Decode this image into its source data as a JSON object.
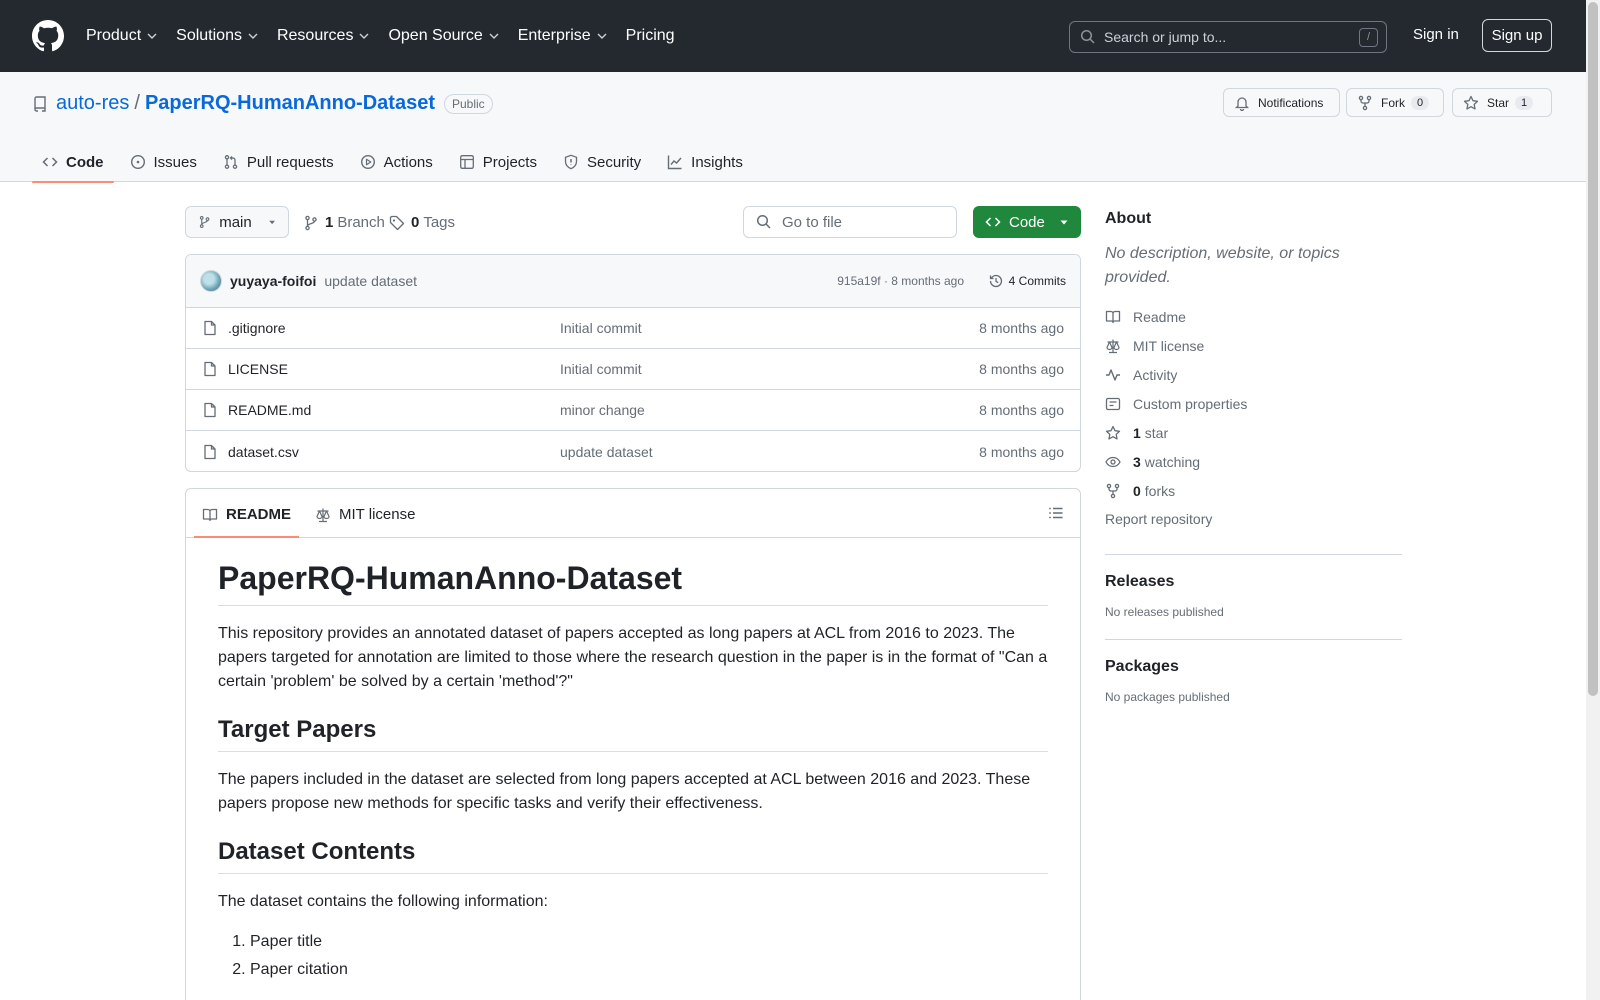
{
  "header": {
    "nav": [
      "Product",
      "Solutions",
      "Resources",
      "Open Source",
      "Enterprise",
      "Pricing"
    ],
    "search_placeholder": "Search or jump to...",
    "search_shortcut": "/",
    "sign_in": "Sign in",
    "sign_up": "Sign up"
  },
  "repo": {
    "owner": "auto-res",
    "separator": "/",
    "name": "PaperRQ-HumanAnno-Dataset",
    "visibility": "Public",
    "notifications_label": "Notifications",
    "fork_label": "Fork",
    "fork_count": "0",
    "star_label": "Star",
    "star_count": "1"
  },
  "tabs": [
    {
      "label": "Code",
      "icon": "code-icon"
    },
    {
      "label": "Issues",
      "icon": "issue-icon"
    },
    {
      "label": "Pull requests",
      "icon": "pull-request-icon"
    },
    {
      "label": "Actions",
      "icon": "play-icon"
    },
    {
      "label": "Projects",
      "icon": "table-icon"
    },
    {
      "label": "Security",
      "icon": "shield-icon"
    },
    {
      "label": "Insights",
      "icon": "graph-icon"
    }
  ],
  "toolbar": {
    "branch": "main",
    "branch_count": "1",
    "branch_label": "Branch",
    "tag_count": "0",
    "tag_label": "Tags",
    "goto_placeholder": "Go to file",
    "code_label": "Code"
  },
  "latest_commit": {
    "author": "yuyaya-foifoi",
    "message": "update dataset",
    "hash_time": "915a19f · 8 months ago",
    "commits_label": "4 Commits"
  },
  "files": [
    {
      "name": ".gitignore",
      "commit": "Initial commit",
      "time": "8 months ago"
    },
    {
      "name": "LICENSE",
      "commit": "Initial commit",
      "time": "8 months ago"
    },
    {
      "name": "README.md",
      "commit": "minor change",
      "time": "8 months ago"
    },
    {
      "name": "dataset.csv",
      "commit": "update dataset",
      "time": "8 months ago"
    }
  ],
  "readme": {
    "tab_readme": "README",
    "tab_license": "MIT license",
    "title": "PaperRQ-HumanAnno-Dataset",
    "intro": "This repository provides an annotated dataset of papers accepted as long papers at ACL from 2016 to 2023. The papers targeted for annotation are limited to those where the research question in the paper is in the format of \"Can a certain 'problem' be solved by a certain 'method'?\"",
    "h_target": "Target Papers",
    "p_target": "The papers included in the dataset are selected from long papers accepted at ACL between 2016 and 2023. These papers propose new methods for specific tasks and verify their effectiveness.",
    "h_contents": "Dataset Contents",
    "p_contents": "The dataset contains the following information:",
    "list": [
      "Paper title",
      "Paper citation"
    ]
  },
  "about": {
    "title": "About",
    "description": "No description, website, or topics provided.",
    "readme": "Readme",
    "license": "MIT license",
    "activity": "Activity",
    "custom": "Custom properties",
    "stars_count": "1",
    "stars_label": "star",
    "watching_count": "3",
    "watching_label": "watching",
    "forks_count": "0",
    "forks_label": "forks",
    "report": "Report repository"
  },
  "releases": {
    "title": "Releases",
    "empty": "No releases published"
  },
  "packages": {
    "title": "Packages",
    "empty": "No packages published"
  }
}
